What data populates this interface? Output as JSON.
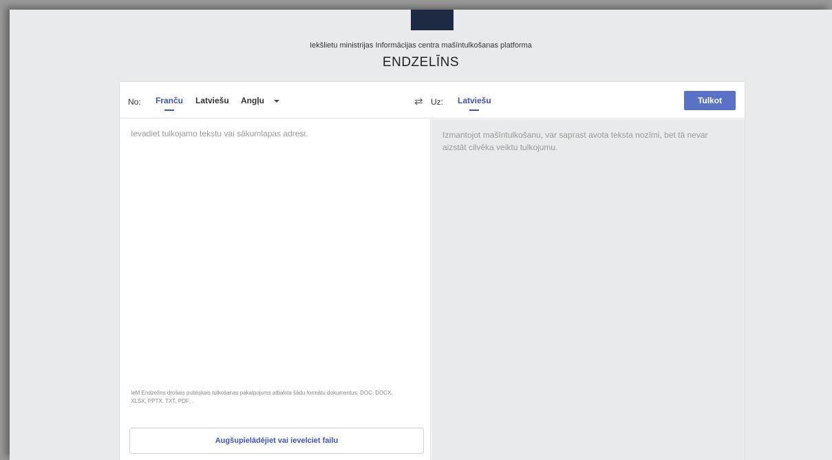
{
  "header": {
    "subtitle": "Iekšlietu ministrijas Informācijas centra mašīntulkošanas platforma",
    "title": "ENDZELĪNS"
  },
  "toolbar": {
    "from_label": "No:",
    "source_languages": [
      "Franču",
      "Latviešu",
      "Angļu"
    ],
    "active_source": "Franču",
    "to_label": "Uz:",
    "target_language": "Latviešu",
    "swap_icon": "swap-arrows-icon",
    "translate_label": "Tulkot"
  },
  "source": {
    "placeholder": "Ievadiet tulkojamo tekstu vai sākumlapas adresi.",
    "formats_note": "IeM Endzelīns drošais publiskais tulkošanas pakalpojums atbalsta šādu formātu dokumentus: DOC, DOCX, XLSX, PPTX, TXT, PDF; .",
    "upload_label": "Augšupielādējiet vai ievelciet failu"
  },
  "target": {
    "note": "Izmantojot mašīntulkošanu, var saprast avota teksta nozīmi, bet tā nevar aizstāt cilvēka veiktu tulkojumu."
  },
  "colors": {
    "accent": "#3d55b5",
    "button": "#5a72c6",
    "background": "#e9eaeb",
    "logo": "#1e2a44"
  }
}
